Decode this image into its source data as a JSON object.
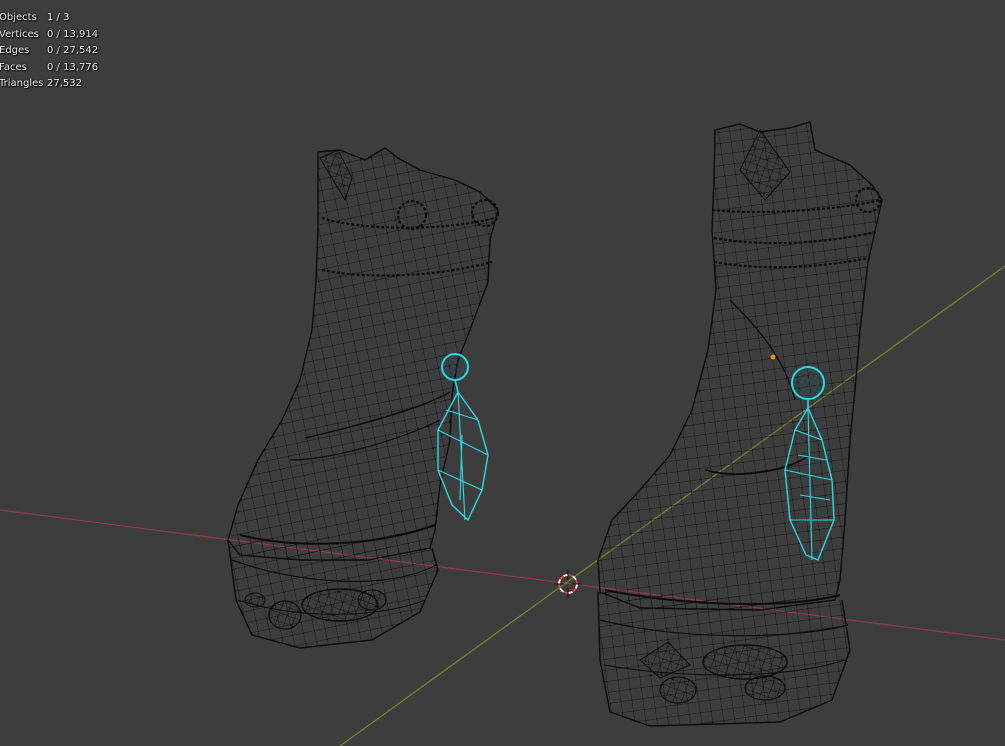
{
  "viewport": {
    "background": "#3d3d3d",
    "stats": [
      {
        "label": "Objects",
        "value": "1 / 3"
      },
      {
        "label": "Vertices",
        "value": "0 / 13,914"
      },
      {
        "label": "Edges",
        "value": "0 / 27,542"
      },
      {
        "label": "Faces",
        "value": "0 / 13,776"
      },
      {
        "label": "Triangles",
        "value": "27,532"
      }
    ],
    "colors": {
      "x_axis": "#9b3a44",
      "y_axis": "#6d8a2f",
      "wire": "#0b0b0b",
      "selected_wire": "#29d9e8",
      "origin": "#f08c14",
      "cursor_red": "#e04040",
      "cursor_white": "#ffffff"
    },
    "objects": [
      {
        "name": "boot-left",
        "selected": false
      },
      {
        "name": "boot-right",
        "selected": false
      },
      {
        "name": "charm-earrings",
        "selected": true
      }
    ],
    "icons": [
      "3d-cursor-icon",
      "origin-point-icon"
    ]
  }
}
